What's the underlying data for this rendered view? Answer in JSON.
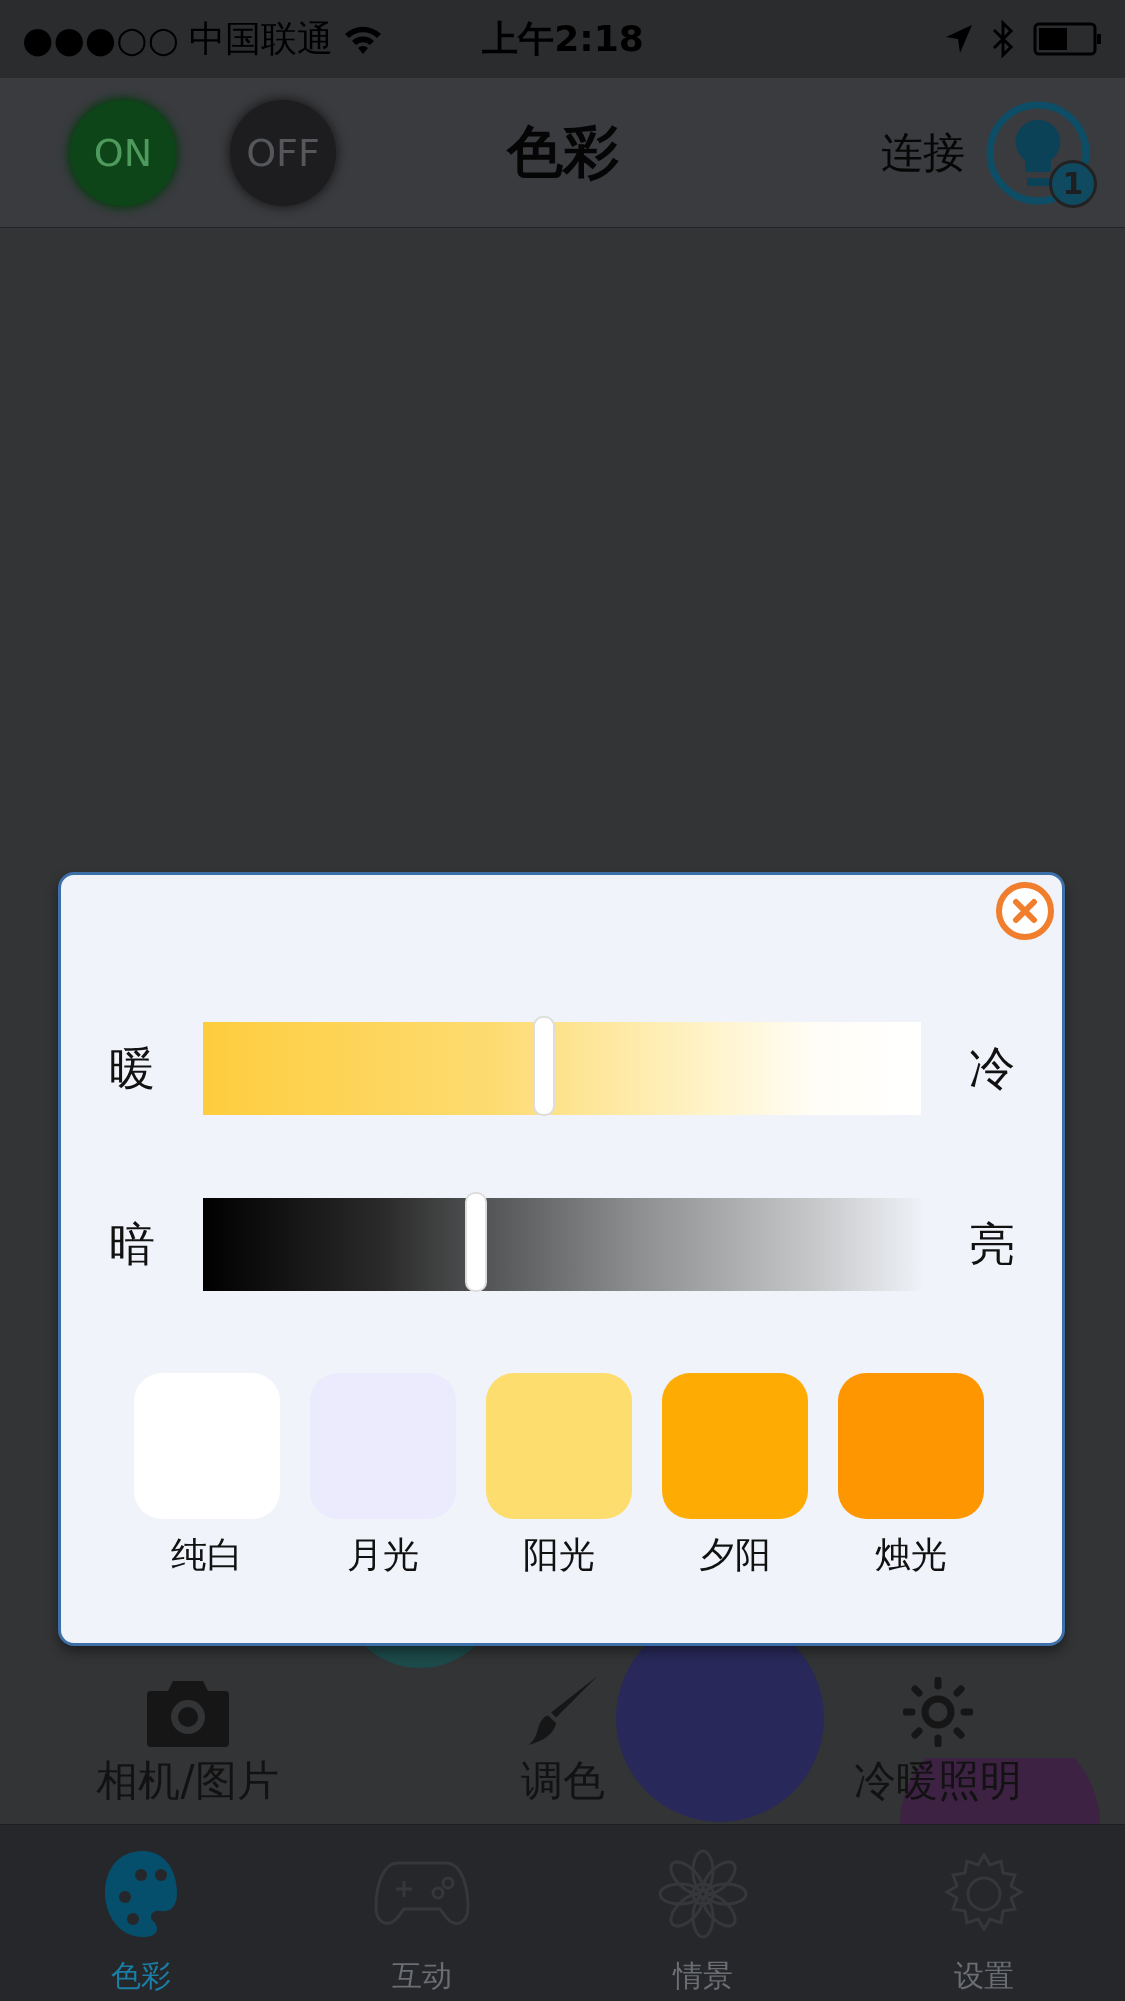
{
  "status_bar": {
    "signal": "●●●○○",
    "carrier": "中国联通",
    "time": "上午2:18"
  },
  "nav_bar": {
    "on_button": "ON",
    "off_button": "OFF",
    "title": "色彩",
    "connect": "连接",
    "badge": "1"
  },
  "dialog": {
    "sliders": [
      {
        "kind": "temperature",
        "left": "暖",
        "right": "冷",
        "level": 0.475
      },
      {
        "kind": "brightness",
        "left": "暗",
        "right": "亮",
        "level": 0.38
      }
    ],
    "presets": [
      {
        "label": "纯白",
        "color": "#ffffff"
      },
      {
        "label": "月光",
        "color": "#ecebfd"
      },
      {
        "label": "阳光",
        "color": "#fedd6f"
      },
      {
        "label": "夕阳",
        "color": "#feac04"
      },
      {
        "label": "烛光",
        "color": "#fe9602"
      }
    ]
  },
  "tools": [
    {
      "kind": "camera",
      "label": "相机/图片"
    },
    {
      "kind": "brush",
      "label": "调色"
    },
    {
      "kind": "sun",
      "label": "冷暖照明"
    }
  ],
  "tabs": [
    {
      "kind": "palette",
      "label": "色彩",
      "selected": true
    },
    {
      "kind": "gamepad",
      "label": "互动",
      "selected": false
    },
    {
      "kind": "flower",
      "label": "情景",
      "selected": false
    },
    {
      "kind": "gear",
      "label": "设置",
      "selected": false
    }
  ]
}
